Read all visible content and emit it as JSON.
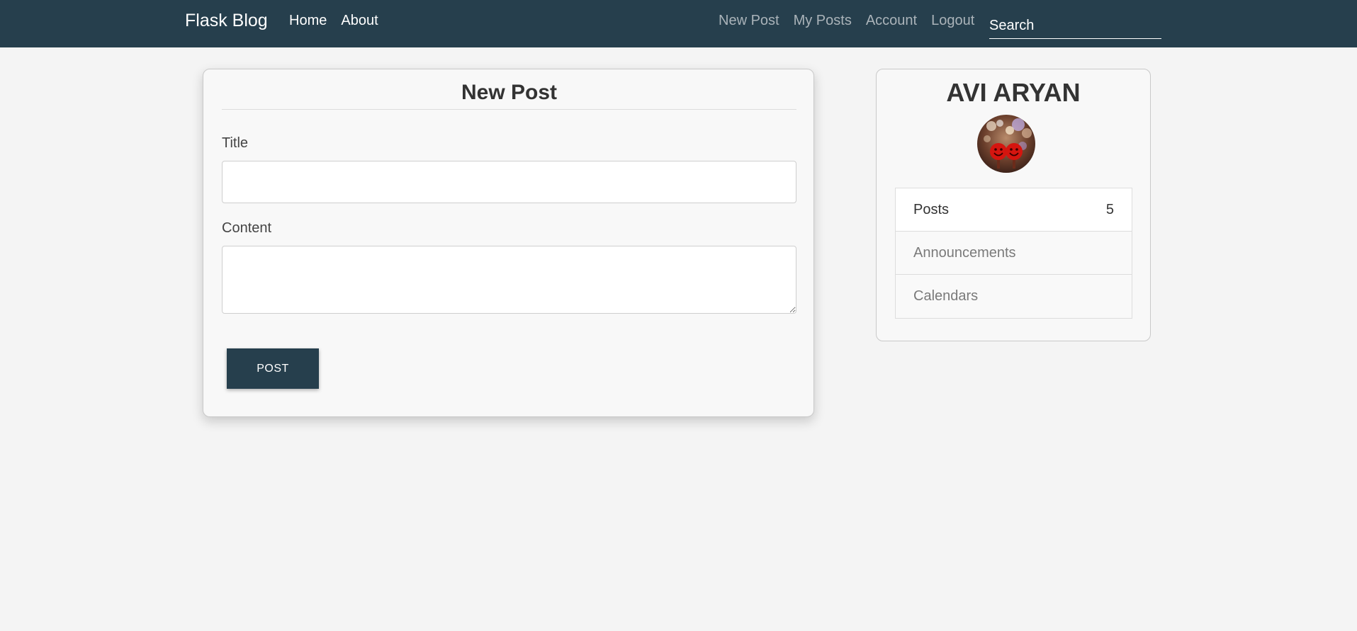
{
  "navbar": {
    "brand": "Flask Blog",
    "left_links": [
      "Home",
      "About"
    ],
    "right_links": [
      "New Post",
      "My Posts",
      "Account",
      "Logout"
    ],
    "search_placeholder": "Search"
  },
  "post_form": {
    "heading": "New Post",
    "title_label": "Title",
    "title_value": "",
    "content_label": "Content",
    "content_value": "",
    "submit_label": "POST"
  },
  "profile": {
    "name": "AVI ARYAN",
    "stats": [
      {
        "label": "Posts",
        "value": "5"
      },
      {
        "label": "Announcements",
        "value": ""
      },
      {
        "label": "Calendars",
        "value": ""
      }
    ]
  },
  "colors": {
    "navbar_bg": "#263f4d",
    "button_bg": "#263f4d",
    "page_bg": "#f4f4f4"
  }
}
